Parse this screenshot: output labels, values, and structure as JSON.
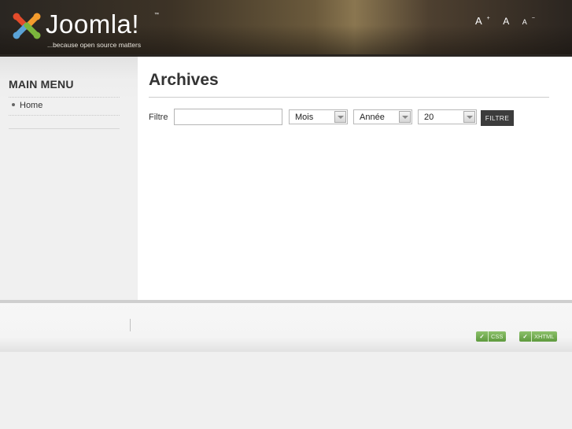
{
  "header": {
    "logo_text": "Joomla!",
    "tagline": "...because open source matters",
    "font_size": {
      "increase": "A",
      "reset": "A",
      "decrease": "A"
    }
  },
  "sidebar": {
    "title": "MAIN MENU",
    "items": [
      {
        "label": "Home"
      }
    ]
  },
  "main": {
    "title": "Archives",
    "filter": {
      "label": "Filtre",
      "input_value": "",
      "month_select": "Mois",
      "year_select": "Année",
      "limit_select": "20",
      "button_label": "FILTRE"
    }
  },
  "footer": {
    "badges": [
      {
        "label": "CSS"
      },
      {
        "label": "XHTML"
      }
    ]
  },
  "colors": {
    "accent_button": "#3c3c3c",
    "badge_green": "#6aa64a"
  }
}
